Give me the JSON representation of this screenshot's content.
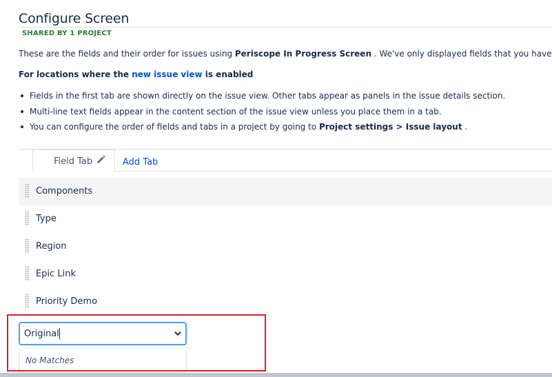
{
  "page": {
    "title": "Configure Screen",
    "shared_badge": "SHARED BY 1 PROJECT",
    "description_prefix": "These are the fields and their order for issues using ",
    "screen_name": "Periscope In Progress Screen",
    "description_suffix": " . We've only displayed fields that you have permissio"
  },
  "locations": {
    "prefix": "For locations where the ",
    "link": "new issue view",
    "suffix": " is enabled"
  },
  "bullets": {
    "b1": "Fields in the first tab are shown directly on the issue view. Other tabs appear as panels in the issue details section.",
    "b2": "Multi-line text fields appear in the content section of the issue view unless you place them in a tab.",
    "b3_prefix": "You can configure the order of fields and tabs in a project by going to ",
    "b3_bold1": "Project settings",
    "b3_sep": " > ",
    "b3_bold2": "Issue layout",
    "b3_suffix": " ."
  },
  "tabs": {
    "active_label": "Field Tab",
    "add_label": "Add Tab"
  },
  "fields": [
    "Components",
    "Type",
    "Region",
    "Epic Link",
    "Priority Demo"
  ],
  "field_select": {
    "value": "Original",
    "no_matches": "No Matches"
  },
  "colors": {
    "link": "#0052cc",
    "shared_badge": "#2e7d32",
    "focus_border": "#4c9aff",
    "annotation_box": "#e21b23"
  }
}
